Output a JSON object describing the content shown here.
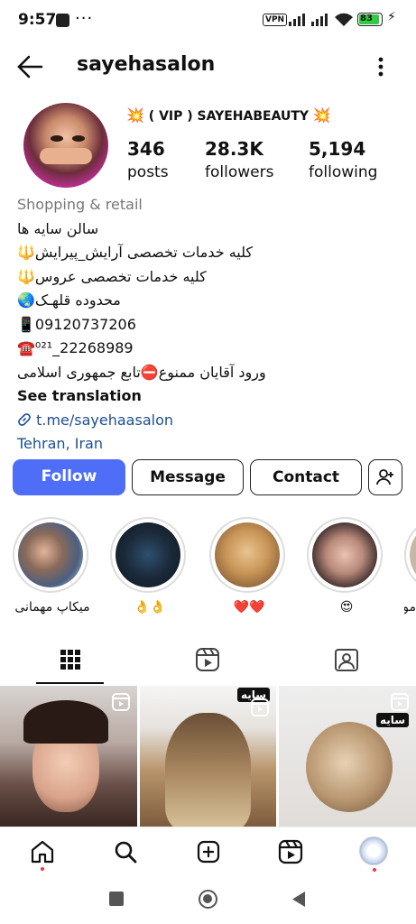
{
  "status_bar": {
    "time": "9:57",
    "more": "···",
    "vpn": "VPN",
    "battery": "83",
    "battery_level": 0.83
  },
  "header": {
    "username": "sayehasalon",
    "back_icon": "arrow-left-icon",
    "menu_icon": "more-vertical-icon"
  },
  "profile": {
    "vip_line": "( VIP ) SAYEHABEAUTY",
    "burst_emoji": "💥",
    "stats": [
      {
        "value": "346",
        "label": "posts"
      },
      {
        "value": "28.3K",
        "label": "followers"
      },
      {
        "value": "5,194",
        "label": "following"
      }
    ]
  },
  "bio": {
    "category": "Shopping & retail",
    "lines": [
      "سالن سایه ها",
      "کلیه خدمات تخصصی آرایش_پیرایش🔱",
      "کلیه خدمات تخصصی عروس🔱",
      "محدوده قلهـک🌏",
      "📱09120737206",
      "☎️⁰²¹_22268989",
      "ورود آقایان ممنوع⛔تابع جمهوری اسلامی"
    ],
    "see_translation": "See translation",
    "link": "t.me/sayehaasalon",
    "location": "Tehran, Iran"
  },
  "buttons": {
    "follow": "Follow",
    "message": "Message",
    "contact": "Contact",
    "add_user_icon": "person-add-icon"
  },
  "highlights": [
    {
      "caption": "میکاپ مهمانی"
    },
    {
      "caption": "👌👌"
    },
    {
      "caption": "❤️❤️"
    },
    {
      "caption": "😍"
    },
    {
      "caption": "مو"
    }
  ],
  "tabs": [
    "grid-icon",
    "reels-icon",
    "tagged-icon"
  ],
  "grid": {
    "watermark": "سایه"
  },
  "colors": {
    "follow_button": "#4f6ef7",
    "link": "#1d4f91",
    "notification_dot": "#ff3040",
    "battery_fill": "#2ecc40"
  },
  "bottom_nav": [
    "home-icon",
    "search-icon",
    "add-post-icon",
    "reels-icon",
    "profile-avatar"
  ]
}
